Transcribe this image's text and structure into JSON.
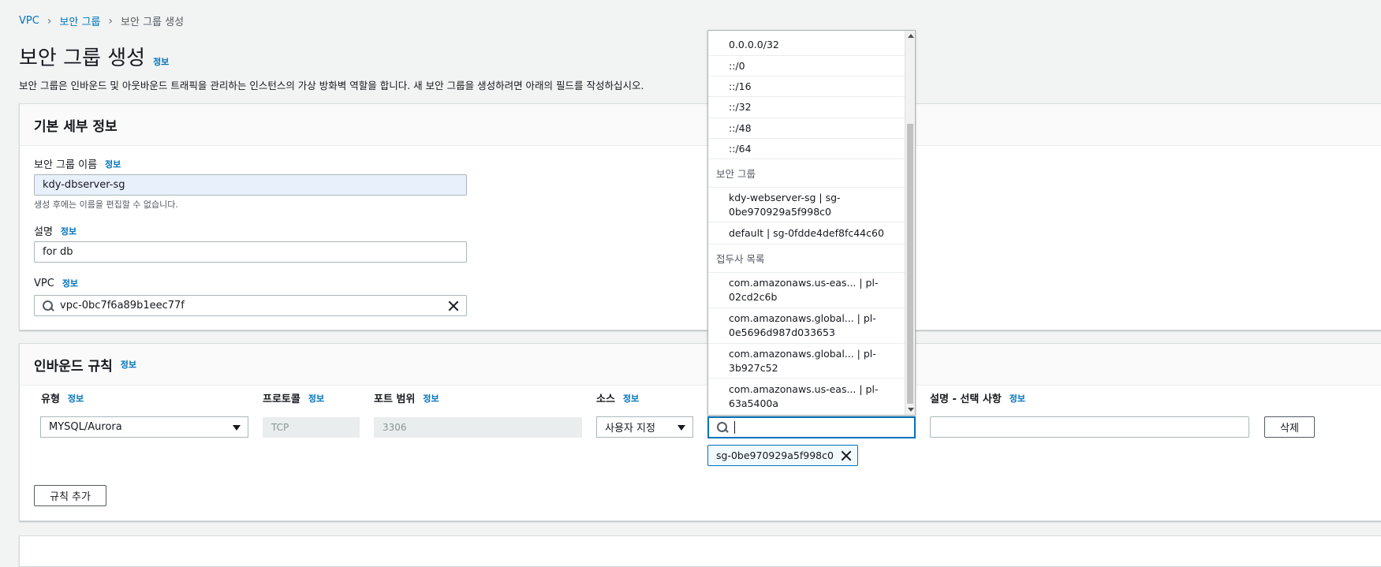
{
  "breadcrumb": {
    "items": [
      "VPC",
      "보안 그룹"
    ],
    "current": "보안 그룹 생성"
  },
  "page": {
    "title": "보안 그룹 생성",
    "info": "정보",
    "description": "보안 그룹은 인바운드 및 아웃바운드 트래픽을 관리하는 인스턴스의 가상 방화벽 역할을 합니다. 새 보안 그룹을 생성하려면 아래의 필드를 작성하십시오."
  },
  "basic_details": {
    "title": "기본 세부 정보",
    "name_label": "보안 그룹 이름",
    "name_value": "kdy-dbserver-sg",
    "name_hint": "생성 후에는 이름을 편집할 수 없습니다.",
    "desc_label": "설명",
    "desc_value": "for db",
    "vpc_label": "VPC",
    "vpc_value": "vpc-0bc7f6a89b1eec77f",
    "info": "정보"
  },
  "inbound": {
    "title": "인바운드 규칙",
    "info": "정보",
    "columns": {
      "type": "유형",
      "protocol": "프로토콜",
      "port": "포트 범위",
      "source": "소스",
      "description": "설명 - 선택 사항"
    },
    "row": {
      "type": "MYSQL/Aurora",
      "protocol": "TCP",
      "port": "3306",
      "source_mode": "사용자 지정",
      "source_search": "",
      "description": "",
      "delete": "삭제",
      "token": "sg-0be970929a5f998c0"
    },
    "add_rule": "규칙 추가"
  },
  "dropdown": {
    "cidr_items": [
      "0.0.0.0/32",
      "::/0",
      "::/16",
      "::/32",
      "::/48",
      "::/64"
    ],
    "sg_group_label": "보안 그룹",
    "sg_items": [
      {
        "line1": "kdy-webserver-sg | sg-",
        "line2": "0be970929a5f998c0"
      },
      {
        "line1": "default | sg-0fdde4def8fc44c60",
        "line2": ""
      }
    ],
    "pl_group_label": "접두사 목록",
    "pl_items": [
      {
        "line1": "com.amazonaws.us-eas... | pl-",
        "line2": "02cd2c6b"
      },
      {
        "line1": "com.amazonaws.global... | pl-",
        "line2": "0e5696d987d033653"
      },
      {
        "line1": "com.amazonaws.global... | pl-",
        "line2": "3b927c52"
      },
      {
        "line1": "com.amazonaws.us-eas... | pl-",
        "line2": "63a5400a"
      }
    ]
  }
}
